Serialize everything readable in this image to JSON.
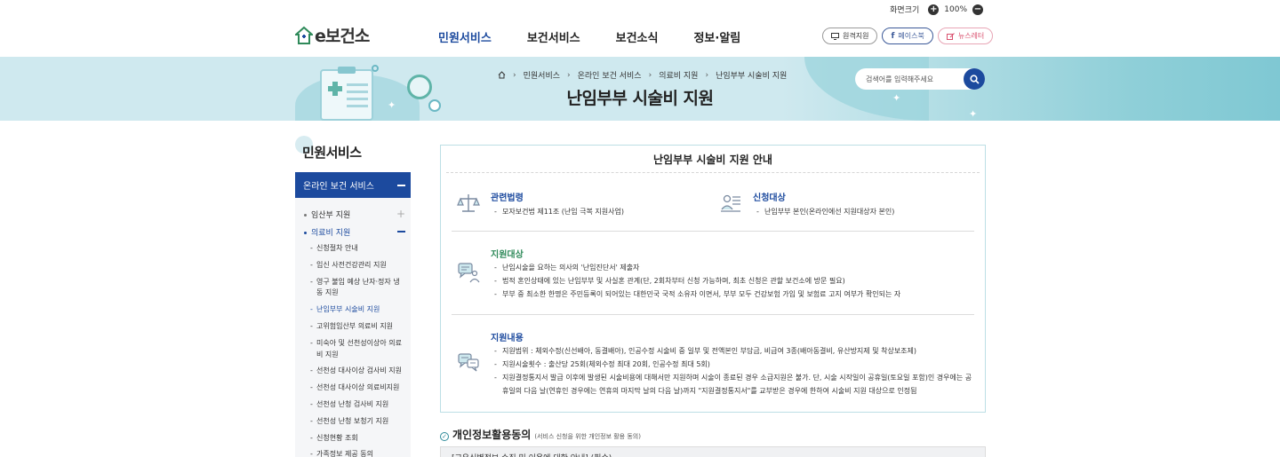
{
  "util": {
    "screen_size_label": "화면크기",
    "zoom": "100%"
  },
  "header": {
    "logo": "e보건소",
    "nav": [
      "민원서비스",
      "보건서비스",
      "보건소식",
      "정보·알림"
    ],
    "ext_links": {
      "remote": "원격지원",
      "facebook": "페이스북",
      "newsletter": "뉴스레터"
    }
  },
  "banner": {
    "breadcrumb": [
      "민원서비스",
      "온라인 보건 서비스",
      "의료비 지원",
      "난임부부 시술비 지원"
    ],
    "title": "난임부부 시술비 지원",
    "search_placeholder": "검색어를 입력해주세요"
  },
  "sidebar": {
    "title": "민원서비스",
    "section": "온라인 보건 서비스",
    "groups": [
      {
        "label": "임산부 지원"
      },
      {
        "label": "의료비 지원"
      }
    ],
    "items": [
      "신청절차 안내",
      "임신 사전건강관리 지원",
      "영구 불임 예상 난자·정자 냉동 지원",
      "난임부부 시술비 지원",
      "고위험임산부 의료비 지원",
      "미숙아 및 선천성이상아 의료비 지원",
      "선천성 대사이상 검사비 지원",
      "선천성 대사이상 의료비지원",
      "선천성 난청 검사비 지원",
      "선천성 난청 보청기 지원",
      "신청현황 조회",
      "가족정보 제공 동의"
    ]
  },
  "panel": {
    "title": "난임부부 시술비 지원 안내",
    "law": {
      "heading": "관련법령",
      "items": [
        "모자보건법 제11조 (난임 극복 지원사업)"
      ]
    },
    "applicant": {
      "heading": "신청대상",
      "items": [
        "난임부부 본인(온라인에선 지원대상자 본인)"
      ]
    },
    "target": {
      "heading": "지원대상",
      "items": [
        "난임시술을 요하는 의사의 '난임진단서' 제출자",
        "법적 혼인상태에 있는 난임부부 및 사실혼 관계(단, 2회차부터 신청 가능하며, 최초 신청은 관할 보건소에 방문 필요)",
        "부부 중 최소한 한명은 주민등록이 되어있는 대한민국 국적 소유자 이면서, 부부 모두 건강보험 가입 및 보험료 고지 여부가 확인되는 자"
      ]
    },
    "content": {
      "heading": "지원내용",
      "items": [
        "지원범위 : 체외수정(신선배아, 동결배아), 인공수정 시술비 중 일부 및 전액본인 부담금, 비급여 3종(배아동결비, 유산방지제 및 착상보조제)",
        "지원시술횟수 : 출산당 25회(체외수정 최대 20회, 인공수정 최대 5회)",
        "지원결정통지서 발급 이후에 발생된 시술비용에 대해서만 지원하며 시술이 종료된 경우 소급지원은 불가. 단, 시술 시작일이 공휴일(토요일 포함)인 경우에는 공휴일의 다음 날(연휴인 경우에는 연휴의 마지막 날의 다음 날)까지 \"지원결정통지서\"를 교부받은 경우에 한하여 시술비 지원 대상으로 인정됨"
      ]
    }
  },
  "consent": {
    "heading": "개인정보활용동의",
    "sub": "(서비스 신청을 위한 개인정보 활용 동의)",
    "accordion": "[고유식별정보 수집 및 이용에 대한 안내] (필수)"
  },
  "colors": {
    "primary": "#1c4a9e",
    "green": "#2f8a5a",
    "banner": "#cfe9ef"
  }
}
